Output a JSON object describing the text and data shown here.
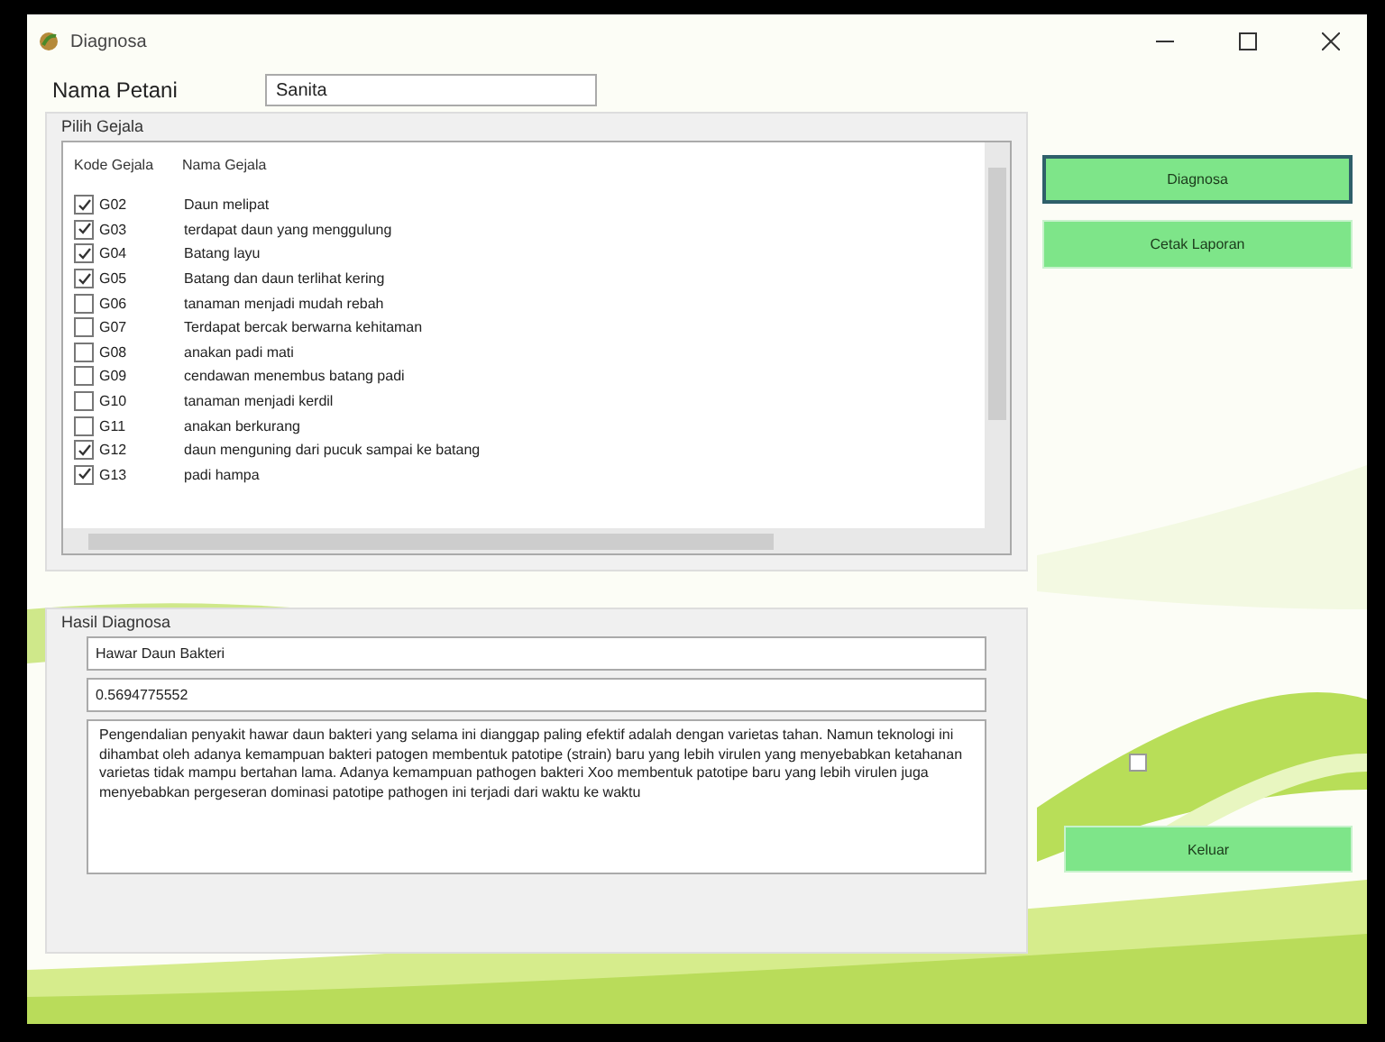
{
  "window": {
    "title": "Diagnosa"
  },
  "farmer": {
    "label": "Nama Petani",
    "value": "Sanita"
  },
  "symptoms": {
    "title": "Pilih Gejala",
    "columns": [
      "Kode Gejala",
      "Nama Gejala"
    ],
    "rows": [
      {
        "code": "G02",
        "name": "Daun melipat",
        "checked": true
      },
      {
        "code": "G03",
        "name": "terdapat daun yang menggulung",
        "checked": true
      },
      {
        "code": "G04",
        "name": "Batang layu",
        "checked": true
      },
      {
        "code": "G05",
        "name": "Batang dan daun terlihat kering",
        "checked": true
      },
      {
        "code": "G06",
        "name": "tanaman menjadi mudah rebah",
        "checked": false
      },
      {
        "code": "G07",
        "name": "Terdapat bercak berwarna kehitaman",
        "checked": false
      },
      {
        "code": "G08",
        "name": "anakan padi mati",
        "checked": false
      },
      {
        "code": "G09",
        "name": "cendawan menembus batang padi",
        "checked": false
      },
      {
        "code": "G10",
        "name": "tanaman menjadi kerdil",
        "checked": false
      },
      {
        "code": "G11",
        "name": "anakan berkurang",
        "checked": false
      },
      {
        "code": "G12",
        "name": "daun menguning dari pucuk sampai ke batang",
        "checked": true
      },
      {
        "code": "G13",
        "name": "padi hampa",
        "checked": true
      }
    ]
  },
  "result": {
    "title": "Hasil Diagnosa",
    "disease": "Hawar Daun Bakteri",
    "score": "0.5694775552",
    "description": "Pengendalian penyakit hawar daun bakteri yang selama ini dianggap paling efektif adalah dengan varietas tahan. Namun teknologi ini dihambat oleh adanya kemampuan bakteri patogen membentuk patotipe (strain) baru yang lebih virulen yang menyebabkan ketahanan varietas tidak mampu bertahan lama. Adanya kemampuan pathogen bakteri Xoo membentuk patotipe baru yang lebih virulen juga menyebabkan pergeseran dominasi patotipe pathogen ini terjadi dari waktu ke waktu"
  },
  "buttons": [
    {
      "label": "Diagnosa",
      "focused": true
    },
    {
      "label": "Cetak Laporan",
      "focused": false
    }
  ],
  "extra_checkbox": {
    "checked": false
  },
  "exit_button": {
    "label": "Keluar"
  }
}
